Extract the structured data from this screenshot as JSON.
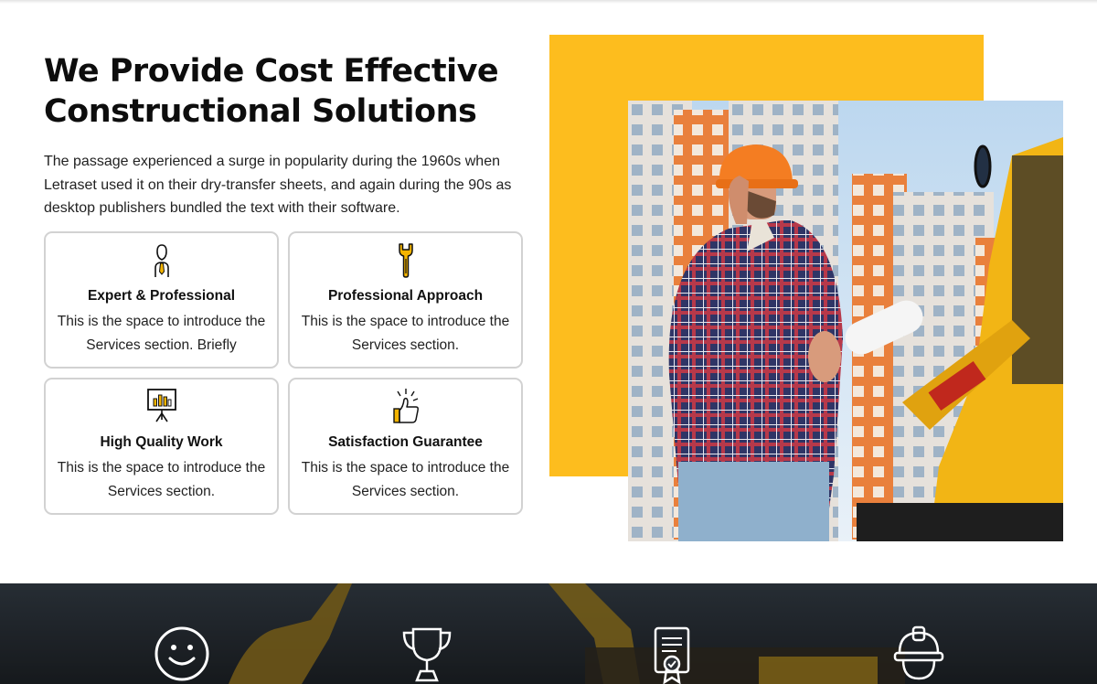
{
  "section": {
    "heading_line1": "We Provide Cost Effective",
    "heading_line2": "Constructional Solutions",
    "intro": "The passage experienced a surge in popularity during the 1960s when Letraset used it on their dry-transfer sheets, and again during the 90s as desktop publishers bundled the text with their software."
  },
  "cards": [
    {
      "icon": "engineer-tie-icon",
      "title": "Expert & Professional",
      "desc": "This is the space to introduce the Services section. Briefly"
    },
    {
      "icon": "wrench-icon",
      "title": "Professional Approach",
      "desc": "This is the space to introduce the Services section."
    },
    {
      "icon": "presentation-board-icon",
      "title": "High Quality Work",
      "desc": "This is the space to introduce the Services section."
    },
    {
      "icon": "thumbs-up-icon",
      "title": "Satisfaction Guarantee",
      "desc": "This is the space to introduce the Services section."
    }
  ],
  "photo": {
    "subject": "construction-worker-on-phone"
  },
  "stats_band": {
    "icons": [
      "smiley-icon",
      "trophy-icon",
      "certificate-icon",
      "hard-hat-icon"
    ]
  },
  "colors": {
    "accent": "#fdbd1e",
    "text": "#111111",
    "card_border": "#d2d2d2",
    "band_dark": "#2a2e33"
  }
}
